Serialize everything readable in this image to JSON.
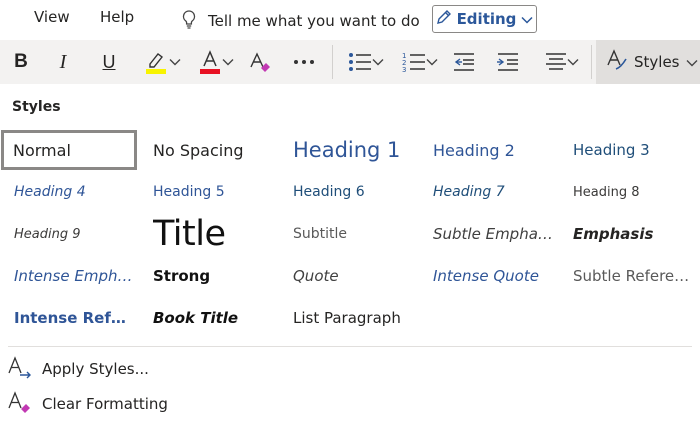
{
  "menu": {
    "view": "View",
    "help": "Help",
    "tell_me": "Tell me what you want to do",
    "editing": "Editing"
  },
  "toolbar": {
    "styles_label": "Styles"
  },
  "icons": {
    "bold": "B",
    "italic": "I",
    "underline": "U",
    "highlight_color": "#f8f400",
    "font_color": "#e81123",
    "brand": "#2b579a"
  },
  "panel": {
    "title": "Styles",
    "styles": [
      "Normal",
      "No Spacing",
      "Heading 1",
      "Heading 2",
      "Heading 3",
      "Heading 4",
      "Heading 5",
      "Heading 6",
      "Heading 7",
      "Heading 8",
      "Heading 9",
      "Title",
      "Subtitle",
      "Subtle Emphasis",
      "Emphasis",
      "Intense Emphasis",
      "Strong",
      "Quote",
      "Intense Quote",
      "Subtle Reference",
      "Intense Reference",
      "Book Title",
      "List Paragraph"
    ],
    "selected": "Normal",
    "apply_styles": "Apply Styles...",
    "clear_formatting": "Clear Formatting"
  }
}
